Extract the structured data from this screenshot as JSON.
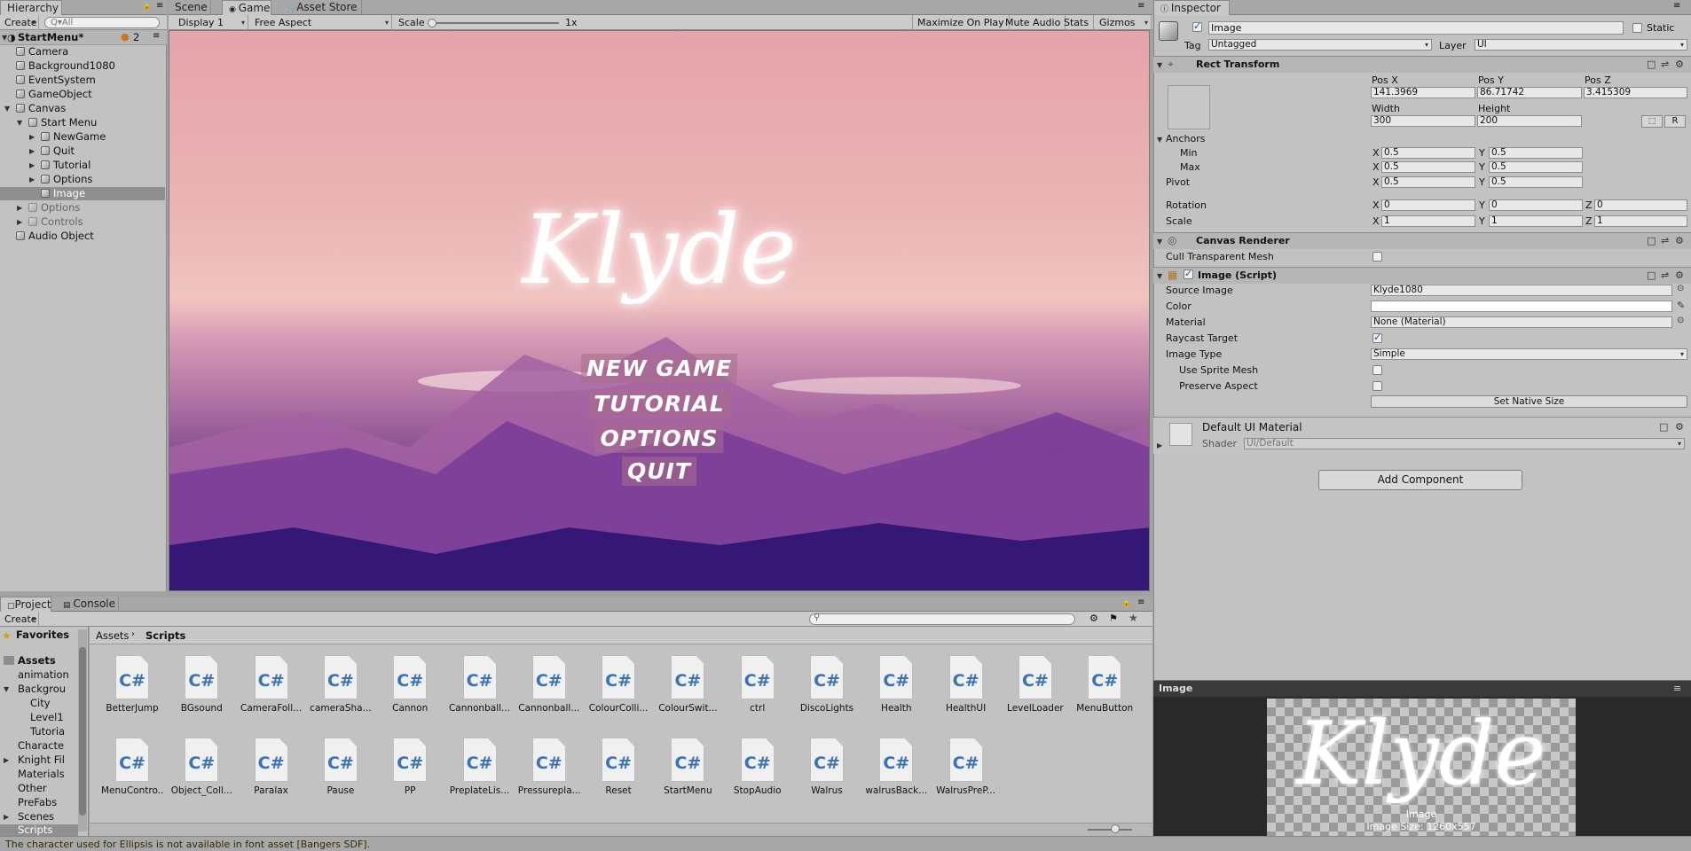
{
  "hierarchy": {
    "tab_label": "Hierarchy",
    "create_label": "Create",
    "search_placeholder": "Q▾All",
    "scene_name": "StartMenu*",
    "user_count": "2",
    "items": [
      {
        "label": "Camera"
      },
      {
        "label": "Background1080"
      },
      {
        "label": "EventSystem"
      },
      {
        "label": "GameObject"
      },
      {
        "label": "Canvas"
      },
      {
        "label": "Start Menu"
      },
      {
        "label": "NewGame"
      },
      {
        "label": "Quit"
      },
      {
        "label": "Tutorial"
      },
      {
        "label": "Options"
      },
      {
        "label": "Image"
      },
      {
        "label": "Options"
      },
      {
        "label": "Controls"
      },
      {
        "label": "Audio Object"
      }
    ]
  },
  "game_view": {
    "tabs": [
      "Scene",
      "Game",
      "Asset Store"
    ],
    "display": "Display 1",
    "aspect": "Free Aspect",
    "scale_label": "Scale",
    "scale_value": "1x",
    "buttons": [
      "Maximize On Play",
      "Mute Audio",
      "Stats",
      "Gizmos"
    ],
    "game_title": "Klyde",
    "menu": [
      "NEW GAME",
      "TUTORIAL",
      "OPTIONS",
      "QUIT"
    ]
  },
  "project": {
    "tabs": [
      "Project",
      "Console"
    ],
    "create_label": "Create",
    "favorites_label": "Favorites",
    "assets_label": "Assets",
    "breadcrumb": [
      "Assets",
      "Scripts"
    ],
    "tree": [
      "animation",
      "Backgrou",
      "City",
      "Level1",
      "Tutoria",
      "Characte",
      "Knight Fil",
      "Materials",
      "Other",
      "PreFabs",
      "Scenes",
      "Scripts"
    ],
    "assets_row1": [
      "BetterJump",
      "BGsound",
      "CameraFoll...",
      "cameraSha...",
      "Cannon",
      "Cannonball...",
      "Cannonball...",
      "ColourColli...",
      "ColourSwit...",
      "ctrl",
      "DiscoLights",
      "Health",
      "HealthUI",
      "LevelLoader",
      "MenuButton"
    ],
    "assets_row2": [
      "MenuContro...",
      "Object_Coll...",
      "Paralax",
      "Pause",
      "PP",
      "PreplateLis...",
      "Pressurepla...",
      "Reset",
      "StartMenu",
      "StopAudio",
      "Walrus",
      "walrusBack...",
      "WalrusPreP..."
    ],
    "file_glyph": "C#"
  },
  "status_bar": "The character used for Ellipsis is not available in font asset [Bangers SDF].",
  "inspector": {
    "tab_label": "Inspector",
    "object_name": "Image",
    "static_label": "Static",
    "tag_label": "Tag",
    "tag_value": "Untagged",
    "layer_label": "Layer",
    "layer_value": "UI",
    "rect": {
      "title": "Rect Transform",
      "posx_label": "Pos X",
      "posy_label": "Pos Y",
      "posz_label": "Pos Z",
      "posx": "141.3969",
      "posy": "86.71742",
      "posz": "3.415309",
      "width_label": "Width",
      "height_label": "Height",
      "width": "300",
      "height": "200",
      "r_btn": "R",
      "anchors_label": "Anchors",
      "min_label": "Min",
      "max_label": "Max",
      "min_x": "0.5",
      "min_y": "0.5",
      "max_x": "0.5",
      "max_y": "0.5",
      "pivot_label": "Pivot",
      "pivot_x": "0.5",
      "pivot_y": "0.5",
      "rotation_label": "Rotation",
      "rot_x": "0",
      "rot_y": "0",
      "rot_z": "0",
      "scale_label": "Scale",
      "scale_x": "1",
      "scale_y": "1",
      "scale_z": "1",
      "x": "X",
      "y": "Y",
      "z": "Z"
    },
    "canvas_renderer": {
      "title": "Canvas Renderer",
      "cull_label": "Cull Transparent Mesh"
    },
    "image_script": {
      "title": "Image (Script)",
      "source_label": "Source Image",
      "source_value": "Klyde1080",
      "color_label": "Color",
      "material_label": "Material",
      "material_value": "None (Material)",
      "raycast_label": "Raycast Target",
      "type_label": "Image Type",
      "type_value": "Simple",
      "sprite_mesh_label": "Use Sprite Mesh",
      "preserve_label": "Preserve Aspect",
      "native_btn": "Set Native Size"
    },
    "material_block": {
      "name": "Default UI Material",
      "shader_label": "Shader",
      "shader_value": "UI/Default"
    },
    "add_component": "Add Component",
    "preview": {
      "title": "Image",
      "caption1": "Image",
      "caption2": "Image Size: 1260x557"
    }
  },
  "colors": {
    "accent_selection": "#8f8f8f",
    "csharp": "#3a73b8",
    "panel": "#c2c2c2"
  }
}
